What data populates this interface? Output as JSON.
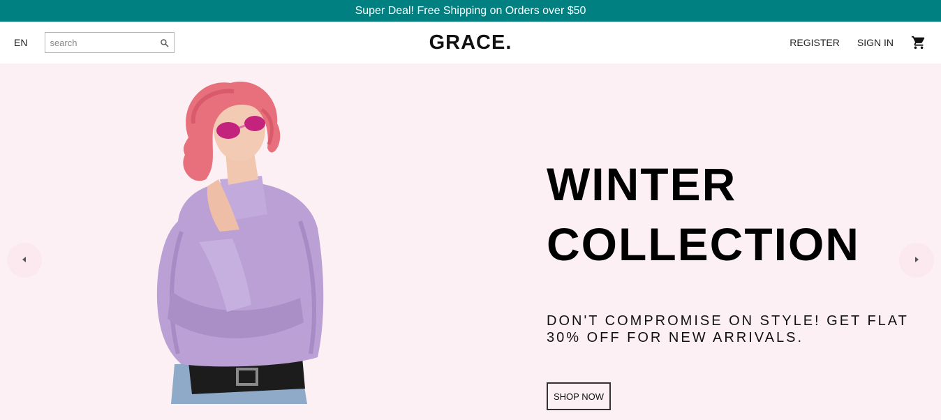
{
  "announcement": {
    "text": "Super Deal! Free Shipping on Orders over $50"
  },
  "navbar": {
    "language": "EN",
    "search_placeholder": "search",
    "logo": "GRACE.",
    "register_label": "REGISTER",
    "signin_label": "SIGN IN",
    "cart_icon": "cart-icon"
  },
  "slider": {
    "title_line1": "WINTER",
    "title_line2": "COLLECTION",
    "description_line1": "DON'T COMPROMISE ON STYLE! GET FLAT",
    "description_line2": "30% OFF FOR NEW ARRIVALS.",
    "button_label": "SHOP NOW",
    "background_color": "#fcf0f4",
    "left_arrow_icon": "arrow-left-icon",
    "right_arrow_icon": "arrow-right-icon"
  },
  "colors": {
    "accent": "#008080"
  }
}
